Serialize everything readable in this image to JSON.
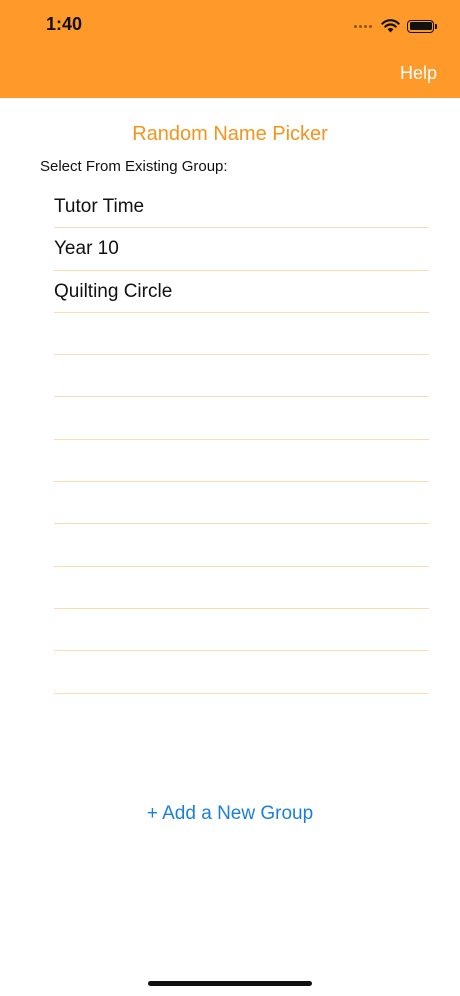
{
  "status_bar": {
    "time": "1:40"
  },
  "navbar": {
    "help_label": "Help",
    "background_color": "#FF9929"
  },
  "main": {
    "title": "Random Name Picker",
    "section_label": "Select From Existing Group:",
    "groups": [
      "Tutor Time",
      "Year 10",
      "Quilting Circle",
      "",
      "",
      "",
      "",
      "",
      "",
      "",
      "",
      ""
    ],
    "add_group_label": "+ Add a New Group"
  },
  "colors": {
    "accent": "#F4941C",
    "link": "#1B7FD8",
    "row_divider": "#F7DDB5"
  }
}
